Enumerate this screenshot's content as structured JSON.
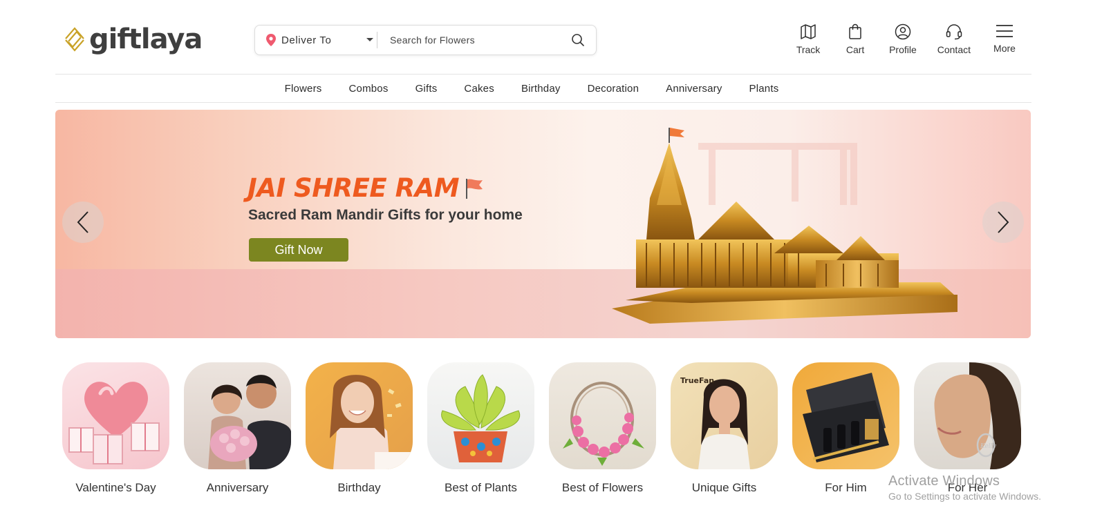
{
  "brand": {
    "name": "giftlaya",
    "accent": "#c9a227"
  },
  "search": {
    "deliver_label": "Deliver To",
    "placeholder": "Search for Flowers"
  },
  "header_actions": [
    {
      "label": "Track",
      "icon": "map-icon"
    },
    {
      "label": "Cart",
      "icon": "shopping-bag-icon"
    },
    {
      "label": "Profile",
      "icon": "user-circle-icon"
    },
    {
      "label": "Contact",
      "icon": "headset-icon"
    },
    {
      "label": "More",
      "icon": "hamburger-menu-icon"
    }
  ],
  "nav": [
    "Flowers",
    "Combos",
    "Gifts",
    "Cakes",
    "Birthday",
    "Decoration",
    "Anniversary",
    "Plants"
  ],
  "banner": {
    "title": "JAI SHREE RAM",
    "subtitle": "Sacred Ram Mandir Gifts for your home",
    "cta": "Gift Now",
    "title_color": "#ee5a1f",
    "cta_color": "#7c8620"
  },
  "categories": [
    {
      "label": "Valentine's Day"
    },
    {
      "label": "Anniversary"
    },
    {
      "label": "Birthday"
    },
    {
      "label": "Best of Plants"
    },
    {
      "label": "Best of Flowers"
    },
    {
      "label": "Unique Gifts",
      "badge": "TrueFan"
    },
    {
      "label": "For Him"
    },
    {
      "label": "For Her"
    }
  ],
  "os_watermark": {
    "title": "Activate Windows",
    "subtitle": "Go to Settings to activate Windows."
  }
}
